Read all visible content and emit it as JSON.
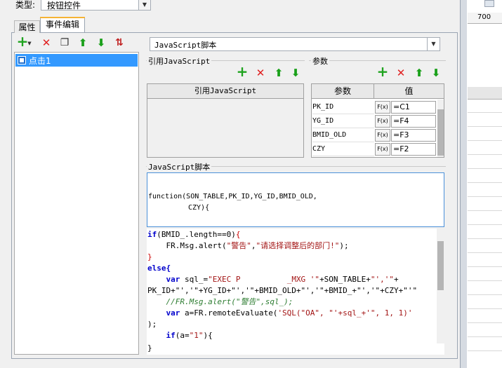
{
  "type_row": {
    "label": "类型:",
    "value": "按钮控件"
  },
  "tabs": {
    "properties": "属性",
    "events": "事件编辑"
  },
  "event_list": {
    "items": [
      "点击1"
    ]
  },
  "script_type": {
    "value": "JavaScript脚本"
  },
  "sections": {
    "ref_js": "引用JavaScript",
    "params": "参数",
    "js_script": "JavaScript脚本"
  },
  "ref_table": {
    "header": "引用JavaScript"
  },
  "param_table": {
    "headers": [
      "参数",
      "值"
    ],
    "fx_label": "F(x)",
    "rows": [
      {
        "name": "PK_ID",
        "value": "=C1"
      },
      {
        "name": "YG_ID",
        "value": "=F4"
      },
      {
        "name": "BMID_OLD",
        "value": "=F3"
      },
      {
        "name": "CZY",
        "value": "=F2"
      }
    ]
  },
  "function_signature": {
    "line1": "function(SON_TABLE,PK_ID,YG_ID,BMID_OLD,",
    "line2": "CZY){"
  },
  "code": {
    "l1_kw": "if",
    "l1_rest": "(BMID_.length==0)",
    "l2_a": "    FR.Msg.alert(",
    "l2_s1": "\"警告\"",
    "l2_b": ",",
    "l2_s2": "\"请选择调整后的部门!\"",
    "l2_c": ");",
    "l3": "}",
    "l4": "else{",
    "l5_kw": "    var",
    "l5_a": " sql_=",
    "l5_s": "\"EXEC P          _MXG '\"",
    "l5_b": "+SON_TABLE+",
    "l5_s2": "\"','\"",
    "l5_c": "+",
    "l6": "PK_ID+\"','\"+YG_ID+\"','\"+BMID_OLD+\"','\"+BMID_+\"','\"+CZY+\"'\"",
    "l7": "    //FR.Msg.alert(\"警告\",sql_);",
    "l8_kw": "    var",
    "l8_a": " a=FR.remoteEvaluate(",
    "l8_s": "'SQL(\"OA\", \"'+sql_+'\", 1, 1)'",
    "l9": ");",
    "l10_kw": "    if",
    "l10_a": "(a=",
    "l10_s": "\"1\"",
    "l10_b": "){",
    "l11": "}"
  },
  "ruler": {
    "label": "700"
  },
  "colors": {
    "selection": "#3399ff",
    "add": "#1fa31f",
    "delete": "#e02020",
    "move": "#1aa01a",
    "tab_accent": "#f5b335"
  }
}
